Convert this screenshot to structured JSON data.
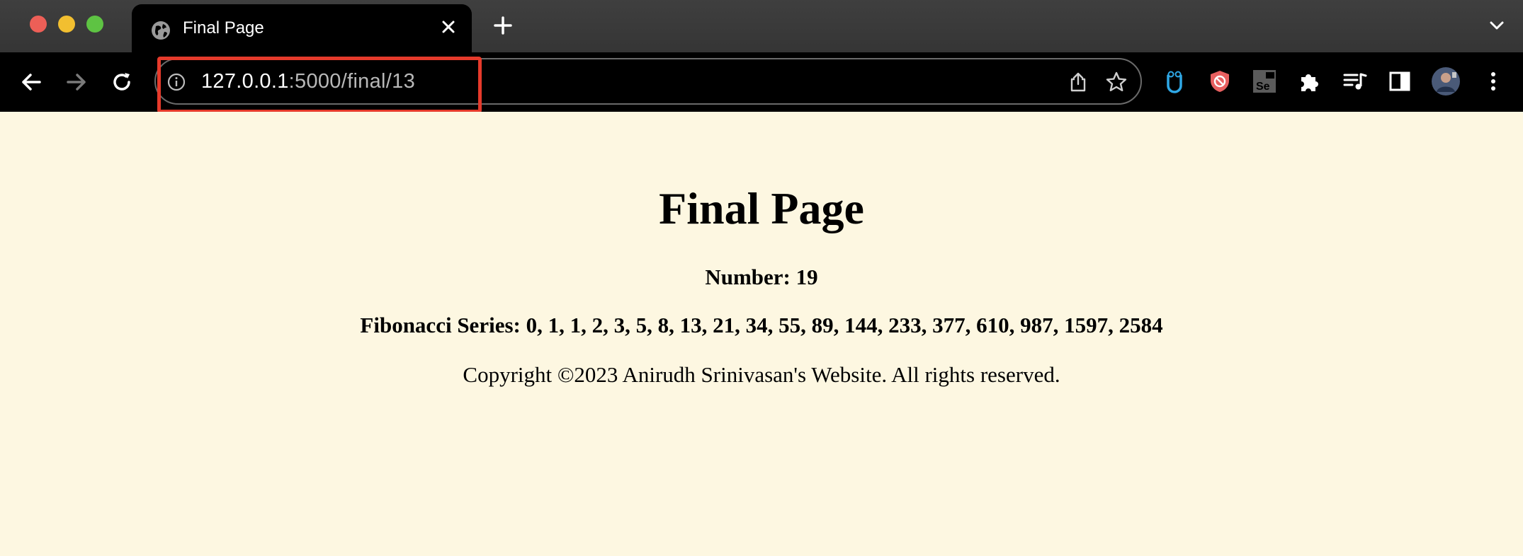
{
  "browser": {
    "tab_title": "Final Page",
    "url_host": "127.0.0.1",
    "url_path": ":5000/final/13",
    "highlight_color": "#e63a2b"
  },
  "icons": {
    "tab": "globe-icon",
    "toolbar": [
      "back-arrow-icon",
      "forward-arrow-icon",
      "reload-icon",
      "info-icon",
      "share-icon",
      "star-icon"
    ],
    "extensions": [
      "owl-extension-icon",
      "shield-extension-icon",
      "selenium-extension-icon",
      "puzzle-icon",
      "media-icon",
      "side-panel-icon",
      "profile-avatar",
      "more-menu-icon"
    ]
  },
  "page": {
    "background": "#fdf7e1",
    "heading": "Final Page",
    "number_line": "Number: 19",
    "fibonacci_line": "Fibonacci Series: 0, 1, 1, 2, 3, 5, 8, 13, 21, 34, 55, 89, 144, 233, 377, 610, 987, 1597, 2584",
    "copyright": "Copyright ©2023 Anirudh Srinivasan's Website. All rights reserved."
  }
}
